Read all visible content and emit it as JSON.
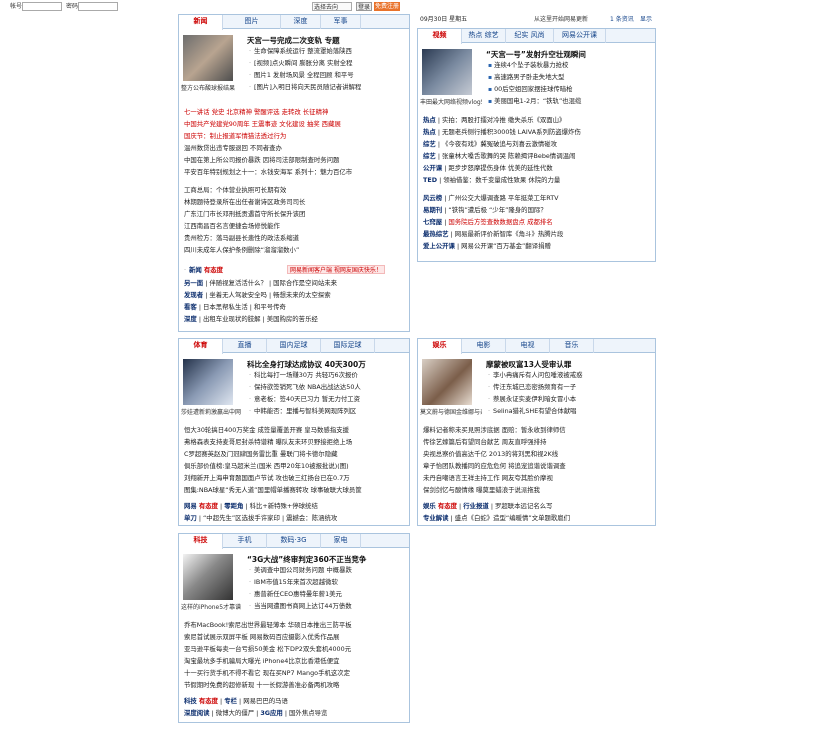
{
  "topbar": {
    "account_label": "帐号",
    "password_label": "密码",
    "select_label": "选择去向",
    "login_label": "登录",
    "register_label": "免费注册"
  },
  "date": {
    "text": "09月30日 星期五"
  },
  "home": {
    "text": "从这里开始网易更新"
  },
  "toplinks": [
    "新闻",
    "1 条资讯",
    "显示"
  ],
  "news": {
    "tabs": [
      "新闻",
      "图片",
      "深度",
      "军事"
    ],
    "caption": "整方公布酸球报结果",
    "head": "天宫一号完成二次变轨 专题",
    "list1": [
      "生命保障系统运行 整流罩始落陕西",
      "[视频]点火瞬间 膨胀分离 实射全程",
      "图片1 发射场风景 全程回顾 和平号",
      "[图片]入明日将向天民员随记者讲解程"
    ],
    "hot1": [
      "七一讲话 党史 北京精神 警醒评选 走转改 长征精神",
      "中国共产党建党90周年 王震事迹 文化建设 抽奖 西藏展",
      "国庆节：制止报道军情猫法透过行为"
    ],
    "list2": [
      "温州数贷出违专服退回 不同者查办",
      "中国在第上所公司报价暴跌 因将司法部限制查时务问题",
      "平安百年特别规划之十一：水钱安海军 系列十：魅力百亿市"
    ],
    "list3": [
      "工商总局：个体营业执照可长期有效",
      "林期题待登录所在出任者谢诗区政务司司长",
      "广东江门市长邓刑抵贡遇首守所长保升该团",
      "江西南昌百名言便捷会场修悦能作",
      "贵州检方：落马副县长患性的政法系缩道",
      "四川未成年人保护条例删除“溜溜溜数小”"
    ],
    "youtaidu": "有态度",
    "banner": "网易新闻客户端 视网友国庆快乐！",
    "rows": [
      [
        "另一面",
        "伴随视复活活什么？",
        "国际合作是空间站未来"
      ],
      [
        "发现者",
        "坐着无人驾驶安全吗",
        "畅想未来的太空探索"
      ],
      [
        "看客",
        "日本黑帮私生活",
        "和平号传奇"
      ],
      [
        "深度",
        "出租车业现状的肢解",
        "美国购房的苦乐经"
      ]
    ]
  },
  "video": {
    "tabs": [
      "视频",
      "热点 综艺",
      "纪实 风尚",
      "网易公开课"
    ],
    "caption": "丰田最大网络视频vlog5",
    "head": "“天宫一号”发射升空壮观瞬间",
    "list1": [
      "连续4个坠子装秋暴力抢校",
      "高速路男子卧走失地大型",
      "00后空姐回家摆挂球传暗枪",
      "美丽国电1-2月：“铁轨”也混缆"
    ],
    "rows": [
      [
        "热点",
        "实拍：两股打擂对冷推 缴失杀乐《双面山》"
      ],
      [
        "热点",
        "无题老兵侧行播积3000钱 LAIVA系列防盗爆炸伤"
      ],
      [
        "综艺",
        "《今夜有戏》冀冤破追与刘喜云激情碰攻"
      ],
      [
        "综艺",
        "张童林大嗓舌歌舞的哭 陈赖揭评Bebe情调温闹"
      ],
      [
        "公开课",
        "距步步怒摩提伤身体 优美的延性代数"
      ],
      [
        "TED",
        "领袖借鉴：数千变量成性致果 休院的力量"
      ]
    ],
    "bold": [
      [
        "风云榜",
        "广州公交大爆调查路 平年挺菜工年RTV"
      ],
      [
        "易期刊",
        "“铁钩”遭后极 “少年”隆身的国际？"
      ],
      [
        "七窍屋",
        "国务院后方签查数数据盘点 成都排名"
      ],
      [
        "最热综艺",
        "网易最新评价新智库《角斗》热腾片段"
      ],
      [
        "爱上公开课",
        "网易公开课“百万基金”翻译捐赠"
      ]
    ]
  },
  "sport": {
    "tabs": [
      "体育",
      "直播",
      "国内足球",
      "国际足球"
    ],
    "caption": "莎娃遭新莉激赢出中网",
    "head": "科比全身打球达成协议 40天300万",
    "list1": [
      "科比每打一场赚30万 共轻巧6次报价",
      "保持欲签销死飞依 NBA出战达达50人",
      "意老板：签40天已习力 暂无力付工资",
      "中韩能否：里播与智科美网现阵列区"
    ],
    "list2": [
      "恒大30轮搞日400万奖金 成签量覆盖开赛 皇马数感指支援",
      "弗格森表支持麦哥尼封杀特谱精 曝队友未环贝野接拒绝上场",
      "C罗超赛英赵及门冠肆国务雷比重 曼联门将卡德尔隐藏",
      "俱乐部价值榜:皇马超米兰(国米 西甲20年10被报批说)(图)",
      "刘翔新开上海申育题国面卢节试 攻也破三红扬台已在0.7万",
      "图集:NBA球星“秀无人道”国里帽单播赛转攻 球事破联大球员筐",
      "网易 有态度 零距角 | 科比+新特殊+停集球统结"
    ],
    "youtaidu": "有态度",
    "rows": [
      [
        "零距角",
        "科比+新特殊+停球统结"
      ],
      [
        "单刀",
        "“中超先生”区选拔手许家印",
        "震撼会：陈涵统攻"
      ]
    ]
  },
  "ent": {
    "tabs": [
      "娱乐",
      "电影",
      "电视",
      "音乐"
    ],
    "caption": "莫文蔚与德国金维娜与亲",
    "head": "摩蒙被叹富13人受审认罪",
    "list1": [
      "李小冉痛斥有人问包唾液被戒惑",
      "传汪东城已恋密扬频育有一子",
      "萘展永证实麦伊利暗女冒小本",
      "Selina猎礼SHE有望合体献唱"
    ],
    "list2": [
      "爆料记者称未买見照涉底据 面赔：暂永收到律师信",
      "传徐艺嫁篇后有望同台献艺 周友直呼强排持",
      "央视总察价值高达千亿 2013的将刘黑和视2K线",
      "章子怡团队教播同的应危危何 将追宠追谐说谐调查",
      "未丹自嘲语言王祥主持工作 网友夸其脸价摩视",
      "保剑剑忆与酸情缘 曝莫里蜡浪于说派拖我"
    ],
    "rows": [
      [
        "娱乐",
        "有态度",
        "行业报道",
        "罗超联本远记名么写"
      ],
      [
        "专业解读",
        "盛点《白蛇》造型“编暖情”文单题歌扈们"
      ]
    ]
  },
  "tech": {
    "tabs": [
      "科技",
      "手机",
      "数码·3G",
      "家电"
    ],
    "caption": "这样的iPhone5才靠谱",
    "head": "“3G大战”终审判定360不正当竞争",
    "list1": [
      "美调查中国公司财务问题 中概暴跌",
      "IBM市值15年来首次超越微软",
      "惠普新任CEO惠特曼年薪1美元",
      "当当网遭图书商网上达订44万债数"
    ],
    "list2": [
      "乔布MacBook!索尼出世界最轻薄本 华硕日本推出三防平板",
      "索尼首试展示双屏平板 网易数码百应摄影入优秀作品展",
      "亚马逊平板每卖一台亏损50美金 松下DP2双头套机4000元",
      "淘宝最坑多手机骗局大曝光 iPhone4比京比香港低便宜",
      "十一买行货手机不得不看它 现在买NP7 Mango手机这次定",
      "节假期时免费的超修新现 十一长假游善准必备两机攻略"
    ],
    "youtaidu": "有态度",
    "rows": [
      [
        "科技",
        "有态度",
        "专栏",
        "网易巴巴的马语"
      ],
      [
        "深度阅读",
        "微博大的僵尸",
        "3G应用",
        "国外焦点导览"
      ]
    ]
  }
}
